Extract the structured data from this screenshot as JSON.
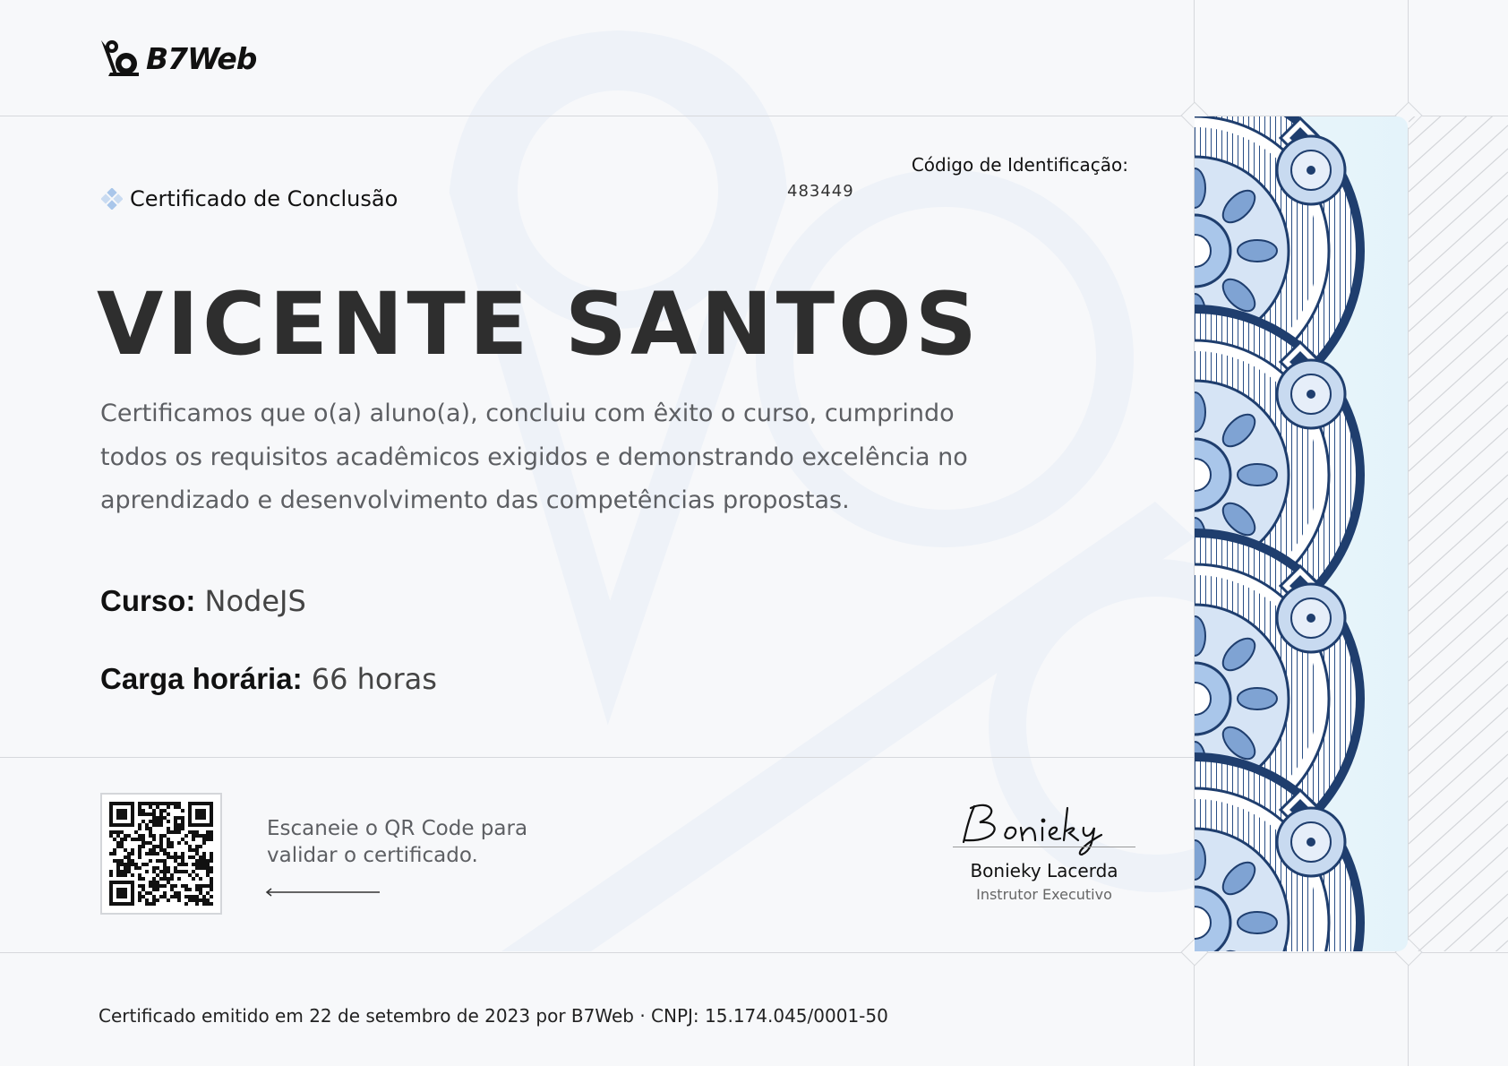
{
  "brand": {
    "name": "B7Web"
  },
  "certificate": {
    "type_label": "Certificado de Conclusão",
    "id_label": "Código de Identificação:",
    "id_value": "483449",
    "student_name": "VICENTE SANTOS",
    "description": "Certificamos que o(a) aluno(a), concluiu com êxito o curso, cumprindo todos os requisitos acadêmicos exigidos e demonstrando excelência no aprendizado e desenvolvimento das competências propostas.",
    "course_label": "Curso:",
    "course_value": "NodeJS",
    "hours_label": "Carga horária:",
    "hours_value": "66 horas"
  },
  "validation": {
    "qr_text": "Escaneie o QR Code para validar o certificado."
  },
  "signature": {
    "handwritten": "Bonieky",
    "name": "Bonieky Lacerda",
    "role": "Instrutor Executivo"
  },
  "footer": {
    "text": "Certificado emitido em 22 de setembro de 2023 por B7Web · CNPJ: 15.174.045/0001-50"
  },
  "colors": {
    "accent": "#1f3e6e",
    "accent_light": "#a9c6ea",
    "text_dark": "#2e2e2e",
    "text_muted": "#5d5f63",
    "border": "#d6d8dc"
  },
  "icons": {
    "logo": "b7web-logo-icon",
    "certificate": "diamond-bullet-icon",
    "arrow": "arrow-left-icon"
  }
}
